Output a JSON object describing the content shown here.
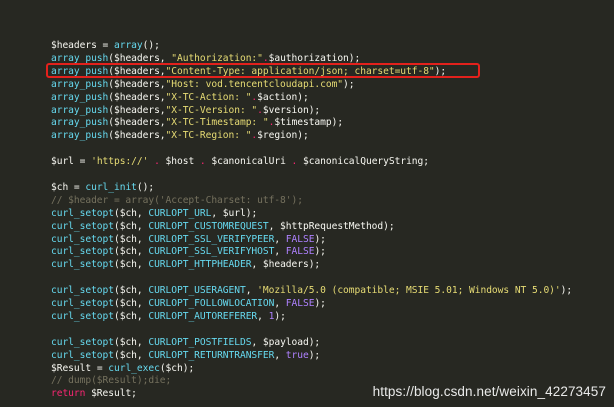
{
  "editor": {
    "colors": {
      "background": "#272822",
      "variable": "#f8f8f2",
      "function": "#66d9ef",
      "string": "#e6db74",
      "operator": "#f92672",
      "constant": "#ae81ff",
      "comment": "#75715e",
      "highlight_box": "#e3211c"
    },
    "lines": [
      [
        {
          "t": "$headers",
          "c": "var"
        },
        {
          "t": " = ",
          "c": "plain"
        },
        {
          "t": "array",
          "c": "func"
        },
        {
          "t": "();",
          "c": "plain"
        }
      ],
      [
        {
          "t": "array_push",
          "c": "func"
        },
        {
          "t": "($headers, ",
          "c": "plain"
        },
        {
          "t": "\"Authorization:\"",
          "c": "str"
        },
        {
          "t": ".",
          "c": "op"
        },
        {
          "t": "$authorization);",
          "c": "plain"
        }
      ],
      [
        {
          "t": "array_push",
          "c": "func"
        },
        {
          "t": "($headers,",
          "c": "plain"
        },
        {
          "t": "\"Content-Type: application/json; charset=utf-8\"",
          "c": "str"
        },
        {
          "t": ");",
          "c": "plain"
        }
      ],
      [
        {
          "t": "array_push",
          "c": "func"
        },
        {
          "t": "($headers,",
          "c": "plain"
        },
        {
          "t": "\"Host: vod.tencentcloudapi.com\"",
          "c": "str"
        },
        {
          "t": ");",
          "c": "plain"
        }
      ],
      [
        {
          "t": "array_push",
          "c": "func"
        },
        {
          "t": "($headers,",
          "c": "plain"
        },
        {
          "t": "\"X-TC-Action: \"",
          "c": "str"
        },
        {
          "t": ".",
          "c": "op"
        },
        {
          "t": "$action);",
          "c": "plain"
        }
      ],
      [
        {
          "t": "array_push",
          "c": "func"
        },
        {
          "t": "($headers,",
          "c": "plain"
        },
        {
          "t": "\"X-TC-Version: \"",
          "c": "str"
        },
        {
          "t": ".",
          "c": "op"
        },
        {
          "t": "$version);",
          "c": "plain"
        }
      ],
      [
        {
          "t": "array_push",
          "c": "func"
        },
        {
          "t": "($headers,",
          "c": "plain"
        },
        {
          "t": "\"X-TC-Timestamp: \"",
          "c": "str"
        },
        {
          "t": ".",
          "c": "op"
        },
        {
          "t": "$timestamp);",
          "c": "plain"
        }
      ],
      [
        {
          "t": "array_push",
          "c": "func"
        },
        {
          "t": "($headers,",
          "c": "plain"
        },
        {
          "t": "\"X-TC-Region: \"",
          "c": "str"
        },
        {
          "t": ".",
          "c": "op"
        },
        {
          "t": "$region);",
          "c": "plain"
        }
      ],
      [],
      [
        {
          "t": "$url",
          "c": "var"
        },
        {
          "t": " = ",
          "c": "plain"
        },
        {
          "t": "'https://'",
          "c": "str"
        },
        {
          "t": " . ",
          "c": "op"
        },
        {
          "t": "$host",
          "c": "var"
        },
        {
          "t": " . ",
          "c": "op"
        },
        {
          "t": "$canonicalUri",
          "c": "var"
        },
        {
          "t": " . ",
          "c": "op"
        },
        {
          "t": "$canonicalQueryString;",
          "c": "var"
        }
      ],
      [],
      [
        {
          "t": "$ch",
          "c": "var"
        },
        {
          "t": " = ",
          "c": "plain"
        },
        {
          "t": "curl_init",
          "c": "func"
        },
        {
          "t": "();",
          "c": "plain"
        }
      ],
      [
        {
          "t": "// $header = array('Accept-Charset: utf-8');",
          "c": "cmt"
        }
      ],
      [
        {
          "t": "curl_setopt",
          "c": "func"
        },
        {
          "t": "($ch, ",
          "c": "plain"
        },
        {
          "t": "CURLOPT_URL",
          "c": "func"
        },
        {
          "t": ", $url);",
          "c": "plain"
        }
      ],
      [
        {
          "t": "curl_setopt",
          "c": "func"
        },
        {
          "t": "($ch, ",
          "c": "plain"
        },
        {
          "t": "CURLOPT_CUSTOMREQUEST",
          "c": "func"
        },
        {
          "t": ", $httpRequestMethod);",
          "c": "plain"
        }
      ],
      [
        {
          "t": "curl_setopt",
          "c": "func"
        },
        {
          "t": "($ch, ",
          "c": "plain"
        },
        {
          "t": "CURLOPT_SSL_VERIFYPEER",
          "c": "func"
        },
        {
          "t": ", ",
          "c": "plain"
        },
        {
          "t": "FALSE",
          "c": "const"
        },
        {
          "t": ");",
          "c": "plain"
        }
      ],
      [
        {
          "t": "curl_setopt",
          "c": "func"
        },
        {
          "t": "($ch, ",
          "c": "plain"
        },
        {
          "t": "CURLOPT_SSL_VERIFYHOST",
          "c": "func"
        },
        {
          "t": ", ",
          "c": "plain"
        },
        {
          "t": "FALSE",
          "c": "const"
        },
        {
          "t": ");",
          "c": "plain"
        }
      ],
      [
        {
          "t": "curl_setopt",
          "c": "func"
        },
        {
          "t": "($ch, ",
          "c": "plain"
        },
        {
          "t": "CURLOPT_HTTPHEADER",
          "c": "func"
        },
        {
          "t": ", $headers);",
          "c": "plain"
        }
      ],
      [],
      [
        {
          "t": "curl_setopt",
          "c": "func"
        },
        {
          "t": "($ch, ",
          "c": "plain"
        },
        {
          "t": "CURLOPT_USERAGENT",
          "c": "func"
        },
        {
          "t": ", ",
          "c": "plain"
        },
        {
          "t": "'Mozilla/5.0 (compatible; MSIE 5.01; Windows NT 5.0)'",
          "c": "str"
        },
        {
          "t": ");",
          "c": "plain"
        }
      ],
      [
        {
          "t": "curl_setopt",
          "c": "func"
        },
        {
          "t": "($ch, ",
          "c": "plain"
        },
        {
          "t": "CURLOPT_FOLLOWLOCATION",
          "c": "func"
        },
        {
          "t": ", ",
          "c": "plain"
        },
        {
          "t": "FALSE",
          "c": "const"
        },
        {
          "t": ");",
          "c": "plain"
        }
      ],
      [
        {
          "t": "curl_setopt",
          "c": "func"
        },
        {
          "t": "($ch, ",
          "c": "plain"
        },
        {
          "t": "CURLOPT_AUTOREFERER",
          "c": "func"
        },
        {
          "t": ", ",
          "c": "plain"
        },
        {
          "t": "1",
          "c": "const"
        },
        {
          "t": ");",
          "c": "plain"
        }
      ],
      [],
      [
        {
          "t": "curl_setopt",
          "c": "func"
        },
        {
          "t": "($ch, ",
          "c": "plain"
        },
        {
          "t": "CURLOPT_POSTFIELDS",
          "c": "func"
        },
        {
          "t": ", $payload);",
          "c": "plain"
        }
      ],
      [
        {
          "t": "curl_setopt",
          "c": "func"
        },
        {
          "t": "($ch, ",
          "c": "plain"
        },
        {
          "t": "CURLOPT_RETURNTRANSFER",
          "c": "func"
        },
        {
          "t": ", ",
          "c": "plain"
        },
        {
          "t": "true",
          "c": "const"
        },
        {
          "t": ");",
          "c": "plain"
        }
      ],
      [
        {
          "t": "$Result",
          "c": "var"
        },
        {
          "t": " = ",
          "c": "plain"
        },
        {
          "t": "curl_exec",
          "c": "func"
        },
        {
          "t": "($ch);",
          "c": "plain"
        }
      ],
      [
        {
          "t": "// dump($Result);die;",
          "c": "cmt"
        }
      ],
      [
        {
          "t": "return",
          "c": "kw"
        },
        {
          "t": " $Result;",
          "c": "plain"
        }
      ]
    ]
  },
  "highlighted_line_index": 2,
  "watermark": "https://blog.csdn.net/weixin_42273457"
}
